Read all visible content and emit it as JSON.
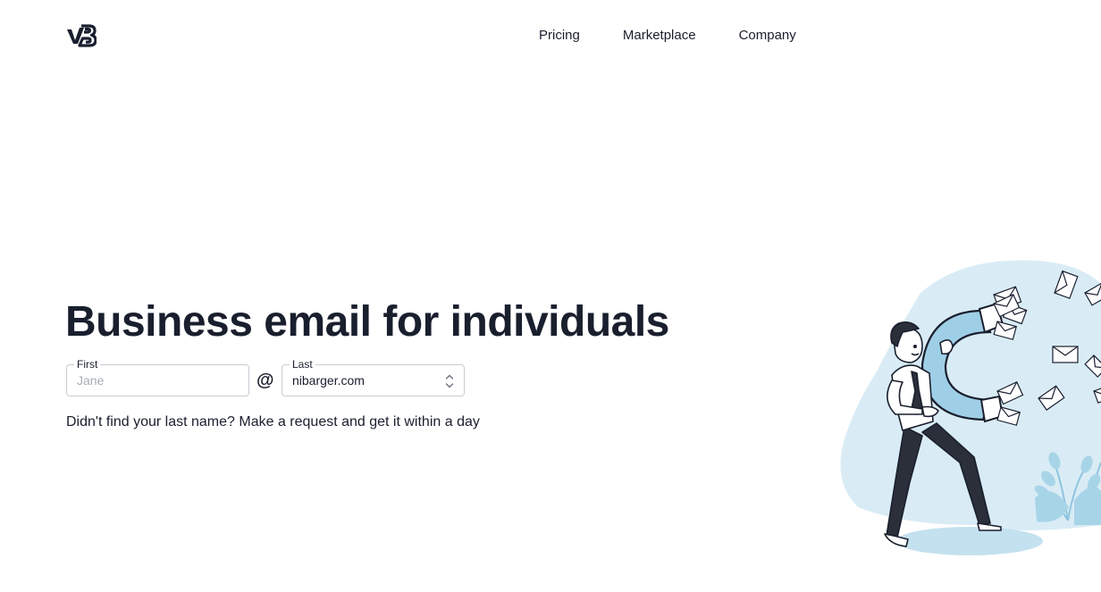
{
  "header": {
    "logo_text": "vB",
    "nav": [
      {
        "label": "Pricing"
      },
      {
        "label": "Marketplace"
      },
      {
        "label": "Company"
      }
    ]
  },
  "hero": {
    "title": "Business email for individuals",
    "first_field": {
      "label": "First",
      "placeholder": "Jane",
      "value": ""
    },
    "at_symbol": "@",
    "last_field": {
      "label": "Last",
      "value": "nibarger.com"
    },
    "request_text": "Didn't find your last name? Make a request and get it within a day"
  },
  "colors": {
    "text": "#1a1f2e",
    "border": "#c9ccd3",
    "illustration_bg": "#d9ecf5",
    "magnet_blue": "#9fcfe6"
  },
  "icons": [
    "logo-icon",
    "select-arrows-icon",
    "magnet-illustration"
  ]
}
